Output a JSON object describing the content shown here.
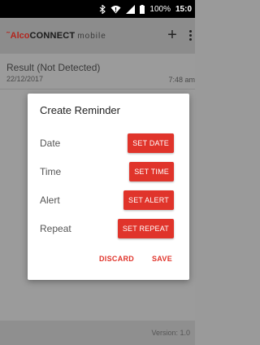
{
  "status_bar": {
    "bluetooth_icon": "bluetooth-icon",
    "wifi_icon": "wifi-icon",
    "signal_icon": "signal-icon",
    "battery_icon": "battery-icon",
    "battery_text": "100%",
    "time": "15:0"
  },
  "app_bar": {
    "brand_alco": "Alco",
    "brand_connect": "CONNECT",
    "brand_mobile": "mobile",
    "add_label": "+"
  },
  "list": {
    "items": [
      {
        "title": "Result (Not Detected)",
        "date": "22/12/2017",
        "time": "7:48 am"
      }
    ]
  },
  "dialog": {
    "title": "Create Reminder",
    "rows": [
      {
        "label": "Date",
        "button": "SET DATE"
      },
      {
        "label": "Time",
        "button": "SET TIME"
      },
      {
        "label": "Alert",
        "button": "SET ALERT"
      },
      {
        "label": "Repeat",
        "button": "SET REPEAT"
      }
    ],
    "discard_label": "DISCARD",
    "save_label": "SAVE"
  },
  "footer": {
    "version": "Version: 1.0"
  },
  "colors": {
    "accent": "#e0342b",
    "brand_red": "#b3261e"
  }
}
